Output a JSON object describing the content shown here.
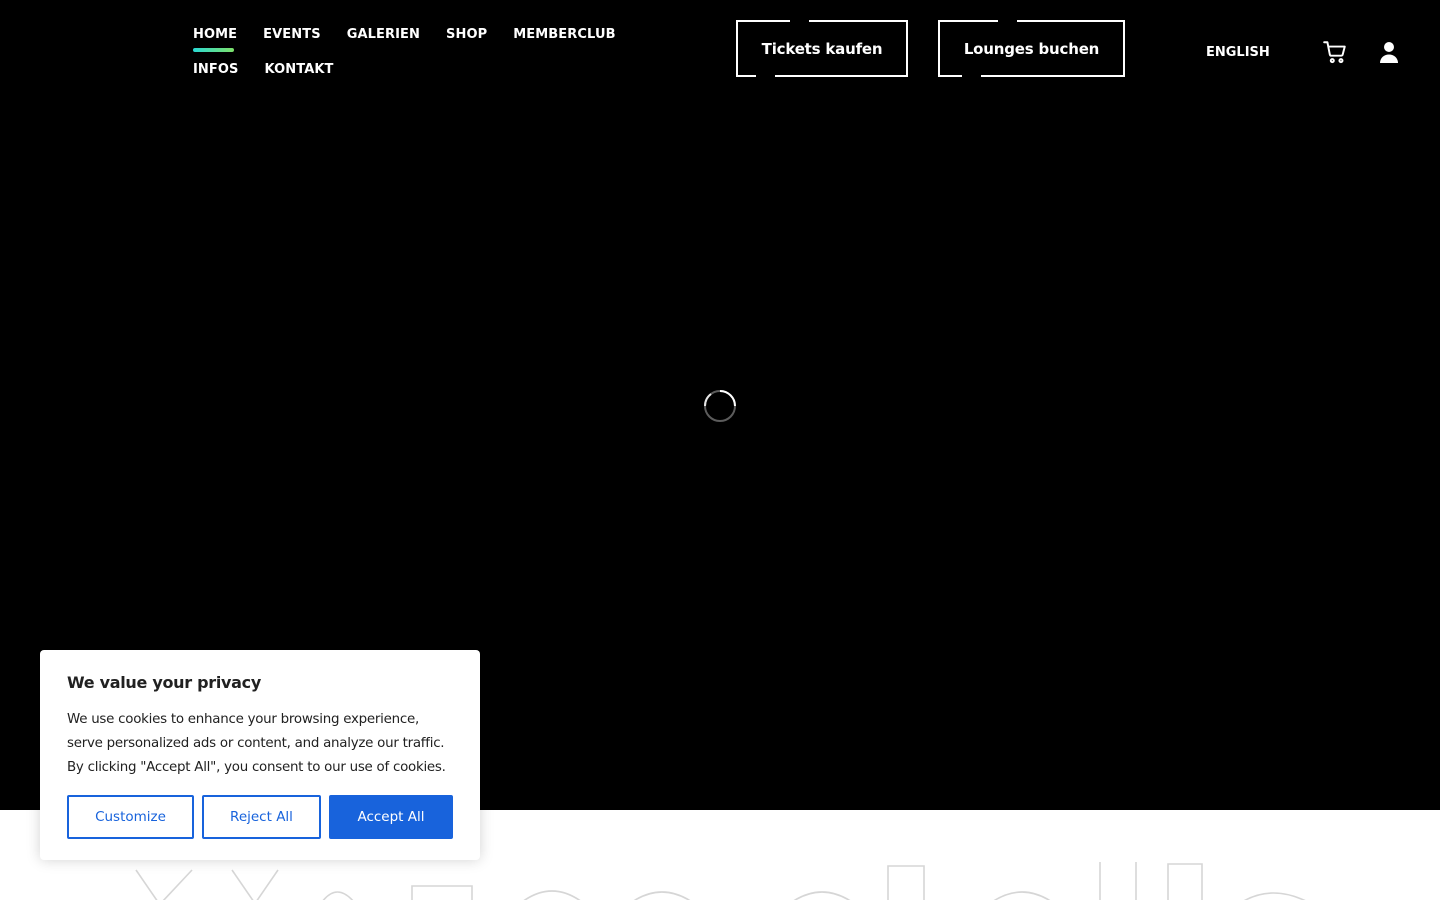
{
  "colors": {
    "background": "#000000",
    "text": "#ffffff",
    "accent_gradient_start": "#2ad9d3",
    "accent_gradient_end": "#7ee16a",
    "cookie_primary": "#1863dc",
    "cookie_text": "#212121"
  },
  "header": {
    "nav": [
      {
        "label": "HOME",
        "active": true
      },
      {
        "label": "EVENTS",
        "active": false
      },
      {
        "label": "GALERIEN",
        "active": false
      },
      {
        "label": "SHOP",
        "active": false
      },
      {
        "label": "MEMBERCLUB",
        "active": false
      },
      {
        "label": "INFOS",
        "active": false
      },
      {
        "label": "KONTAKT",
        "active": false
      }
    ],
    "tickets_button": "Tickets kaufen",
    "lounges_button": "Lounges buchen",
    "language": "ENGLISH",
    "icons": {
      "cart": "shopping-cart-icon",
      "account": "user-icon"
    }
  },
  "hero": {
    "icon": "loading-spinner-icon"
  },
  "cookie_banner": {
    "title": "We value your privacy",
    "text": "We use cookies to enhance your browsing experience, serve personalized ads or content, and analyze our traffic. By clicking \"Accept All\", you consent to our use of cookies.",
    "customize": "Customize",
    "reject": "Reject All",
    "accept": "Accept All"
  }
}
